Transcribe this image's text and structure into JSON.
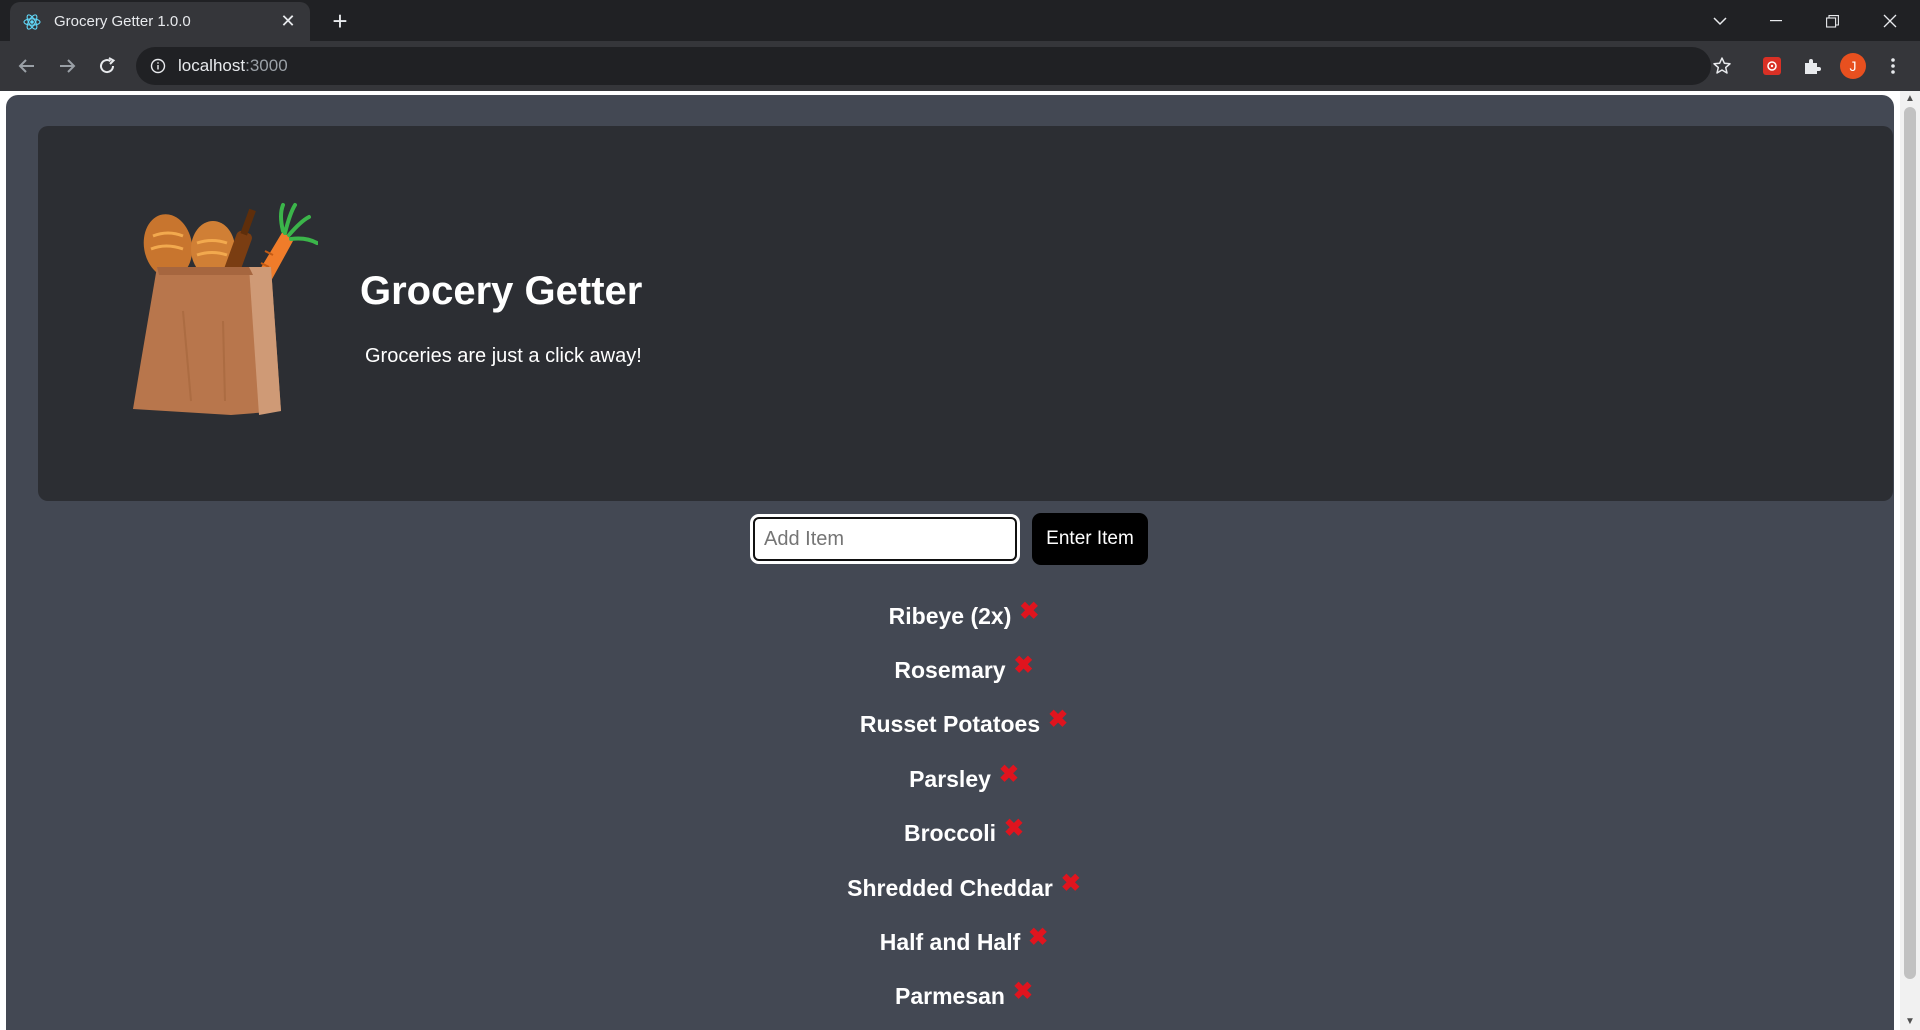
{
  "browser": {
    "tab_title": "Grocery Getter 1.0.0",
    "url_host": "localhost",
    "url_port": ":3000",
    "profile_initial": "J"
  },
  "app": {
    "title": "Grocery Getter",
    "subtitle": "Groceries are just a click away!",
    "input_placeholder": "Add Item",
    "input_value": "",
    "enter_button_label": "Enter Item",
    "delete_glyph": "✖",
    "items": [
      "Ribeye (2x)",
      "Rosemary",
      "Russet Potatoes",
      "Parsley",
      "Broccoli",
      "Shredded Cheddar",
      "Half and Half",
      "Parmesan"
    ]
  },
  "colors": {
    "page_bg": "#434853",
    "header_bg": "#2c2e33",
    "delete_icon": "#e0141e"
  }
}
